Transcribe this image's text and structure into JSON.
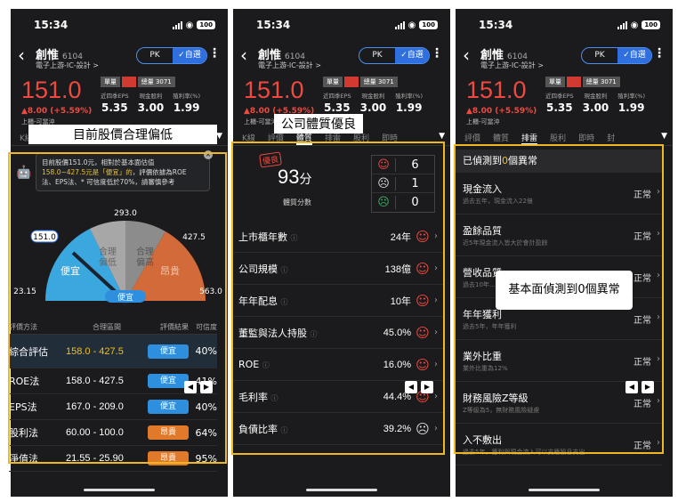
{
  "status": {
    "time": "15:34",
    "battery": "100"
  },
  "stock": {
    "name": "創惟",
    "code": "6104",
    "industry": "電子上游-IC-設計 >",
    "price": "151.0",
    "change": "▲8.00 (+5.59%)",
    "trade": "上櫃-可當沖",
    "tags": [
      "單量",
      "總量 3071"
    ],
    "metrics": [
      {
        "label": "近四季EPS",
        "value": "5.35"
      },
      {
        "label": "現金股利",
        "value": "3.00"
      },
      {
        "label": "殖利率(%)",
        "value": "1.99"
      }
    ]
  },
  "pill": {
    "pk": "PK",
    "selected": "✓自選"
  },
  "tabs": [
    "K線",
    "評價",
    "體質",
    "排雷",
    "股利",
    "即時",
    "封"
  ],
  "callouts": {
    "p1": "目前股價合理偏低",
    "p2": "公司體質優良",
    "p3": "基本面偵測到0個異常"
  },
  "valuation_note": {
    "line1": "目前股價151.0元，相對於基本面估值",
    "line2_hl": "158.0~427.5元是「便宜」的",
    "line2_rest": "，評價依據為ROE",
    "line3": "法、EPS法、* 可信度低於70%，請審慎參考"
  },
  "gauge": {
    "top": "293.0",
    "left": "151.0",
    "right": "427.5",
    "min": "23.15",
    "max": "563.0",
    "zones": [
      "便宜",
      "合理偏低",
      "合理偏高",
      "昂貴"
    ],
    "pointer_label": "便宜",
    "current_fraction": 0.236
  },
  "vtable": {
    "headers": [
      "評價方法",
      "合理區間",
      "評價結果",
      "可信度"
    ],
    "rows": [
      {
        "method": "綜合評估",
        "range": "158.0 - 427.5",
        "result": "便宜",
        "conf": "40%"
      },
      {
        "method": "ROE法",
        "range": "158.0 - 427.5",
        "result": "便宜",
        "conf": "41%"
      },
      {
        "method": "EPS法",
        "range": "167.0 - 209.0",
        "result": "便宜",
        "conf": "40%"
      },
      {
        "method": "股利法",
        "range": "60.00 - 100.0",
        "result": "昂貴",
        "conf": "64%"
      },
      {
        "method": "淨值法",
        "range": "21.55 - 25.90",
        "result": "昂貴",
        "conf": "95%"
      }
    ]
  },
  "quality": {
    "stamp": "優良",
    "score": "93",
    "score_unit": "分",
    "score_label": "體質分數",
    "counts": [
      {
        "icon": "☺",
        "n": "6"
      },
      {
        "icon": "☹",
        "n": "1"
      },
      {
        "icon": "☹",
        "n": "0"
      }
    ],
    "rows": [
      {
        "label": "上市櫃年數",
        "value": "24年",
        "face": "☺"
      },
      {
        "label": "公司規模",
        "value": "138億",
        "face": "☺"
      },
      {
        "label": "年年配息",
        "value": "10年",
        "face": "☺"
      },
      {
        "label": "董監與法人持股",
        "value": "45.0%",
        "face": "☺"
      },
      {
        "label": "ROE",
        "value": "16.0%",
        "face": "☺"
      },
      {
        "label": "毛利率",
        "value": "44.4%",
        "face": "☺"
      },
      {
        "label": "負債比率",
        "value": "39.2%",
        "face": "☹"
      }
    ]
  },
  "anomaly": {
    "head_pre": "已偵測到",
    "head_num": "0",
    "head_post": "個異常",
    "rows": [
      {
        "title": "現金流入",
        "sub": "過去五年，現金流入22億",
        "status": "正常"
      },
      {
        "title": "盈餘品質",
        "sub": "近5年現金流入皆大於會計盈餘",
        "status": "正常"
      },
      {
        "title": "營收品質",
        "sub": "過去10年...",
        "status": "正常"
      },
      {
        "title": "年年獲利",
        "sub": "過去5年，年年獲利",
        "status": "正常"
      },
      {
        "title": "業外比重",
        "sub": "業外比重為12%",
        "status": "正常"
      },
      {
        "title": "財務風險Z等級",
        "sub": "Z等級為5，無財務風險疑慮",
        "status": "正常"
      },
      {
        "title": "入不敷出",
        "sub": "過去5年，獲利與現金流入可以支應股息支出",
        "status": "正常"
      }
    ]
  }
}
